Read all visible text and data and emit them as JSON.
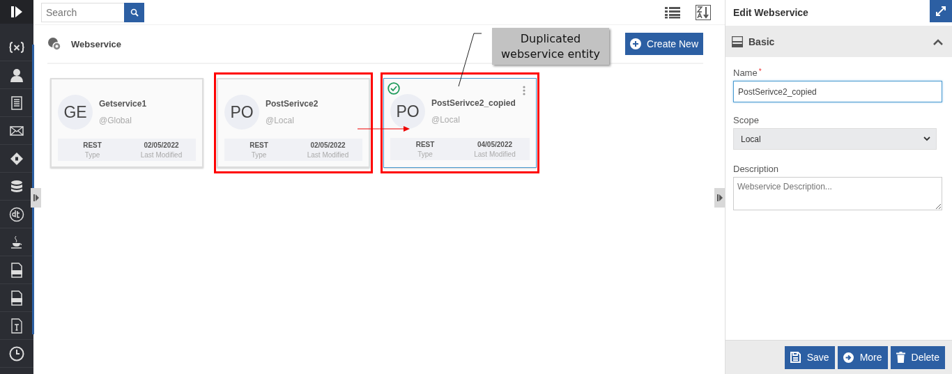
{
  "search": {
    "placeholder": "Search"
  },
  "header": {
    "title": "Webservice",
    "create_button": "Create New"
  },
  "cards": [
    {
      "initials": "GE",
      "name": "Getservice1",
      "scope": "@Global",
      "type": "REST",
      "type_label": "Type",
      "modified": "02/05/2022",
      "modified_label": "Last Modified",
      "selected": false,
      "annotated": false
    },
    {
      "initials": "PO",
      "name": "PostSerivce2",
      "scope": "@Local",
      "type": "REST",
      "type_label": "Type",
      "modified": "02/05/2022",
      "modified_label": "Last Modified",
      "selected": false,
      "annotated": true
    },
    {
      "initials": "PO",
      "name": "PostSerivce2_copied",
      "scope": "@Local",
      "type": "REST",
      "type_label": "Type",
      "modified": "04/05/2022",
      "modified_label": "Last Modified",
      "selected": true,
      "annotated": true
    }
  ],
  "callout": {
    "text": "Duplicated webservice entity"
  },
  "panel": {
    "title": "Edit Webservice",
    "section": "Basic",
    "expanded": true,
    "name": {
      "label": "Name",
      "required": true,
      "required_mark": "*",
      "value": "PostSerivce2_copied"
    },
    "scope": {
      "label": "Scope",
      "value": "Local"
    },
    "description": {
      "label": "Description",
      "placeholder": "Webservice Description..."
    },
    "buttons": [
      {
        "kind": "save",
        "label": "Save"
      },
      {
        "kind": "more",
        "label": "More"
      },
      {
        "kind": "delete",
        "label": "Delete"
      }
    ]
  }
}
